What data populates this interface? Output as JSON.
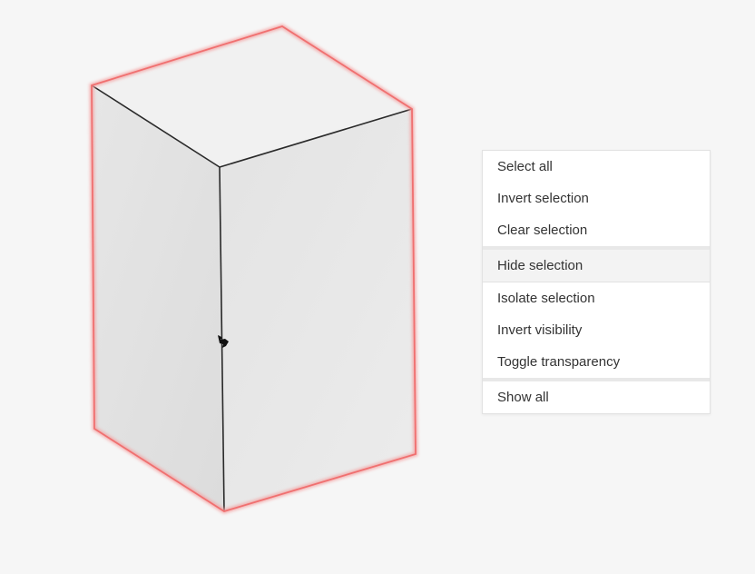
{
  "context_menu": {
    "items": [
      {
        "label": "Select all"
      },
      {
        "label": "Invert selection"
      },
      {
        "label": "Clear selection"
      },
      {
        "label": "Hide selection"
      },
      {
        "label": "Isolate selection"
      },
      {
        "label": "Invert visibility"
      },
      {
        "label": "Toggle transparency"
      },
      {
        "label": "Show all"
      }
    ]
  },
  "colors": {
    "background": "#f6f6f6",
    "selection_outline": "#f07070",
    "highlight_row": "#f3f3f3"
  }
}
